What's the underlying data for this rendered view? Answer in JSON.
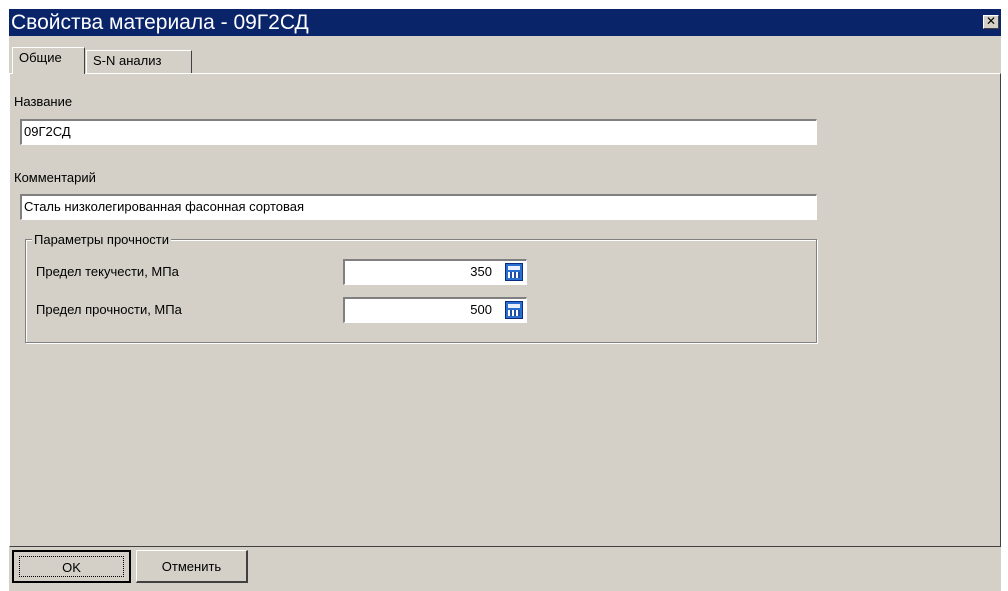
{
  "window": {
    "title": "Свойства материала - 09Г2СД",
    "close_glyph": "✕"
  },
  "tabs": [
    {
      "label": "Общие",
      "active": true
    },
    {
      "label": "S-N анализ",
      "active": false
    }
  ],
  "form": {
    "name_label": "Название",
    "name_value": "09Г2СД",
    "comment_label": "Комментарий",
    "comment_value": "Сталь низколегированная фасонная сортовая"
  },
  "strength_group": {
    "title": "Параметры прочности",
    "yield_label": "Предел текучести, МПа",
    "yield_value": "350",
    "ultimate_label": "Предел прочности, МПа",
    "ultimate_value": "500"
  },
  "buttons": {
    "ok_label": "OK",
    "cancel_label": "Отменить"
  },
  "colors": {
    "titlebar": "#0a246a",
    "face": "#d4d0c8",
    "calc_icon": "#2a6fd0"
  },
  "icons": [
    "close-icon",
    "calculator-icon"
  ]
}
